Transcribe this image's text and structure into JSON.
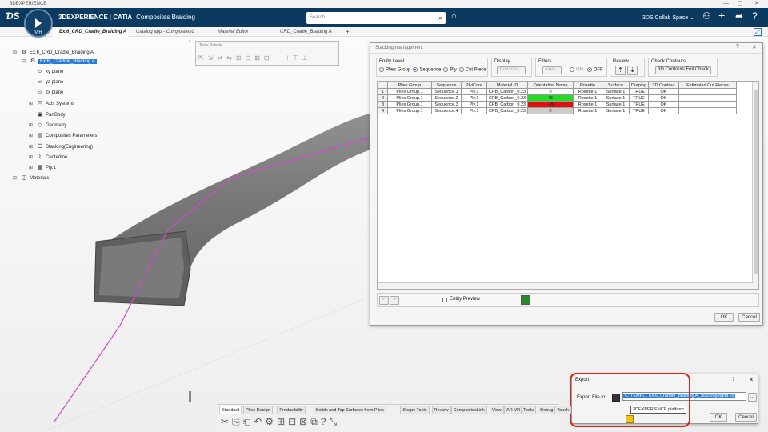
{
  "titlebar": {
    "app": "3DEXPERIENCE",
    "min": "—",
    "max": "▢",
    "close": "✕"
  },
  "header": {
    "brand_3dx": "3DEXPERIENCE",
    "brand_sep": " | ",
    "brand_catia": "CATIA",
    "app_name": "Composites Braiding",
    "compass_label": "V.R",
    "search_placeholder": "Search",
    "collab_space": "3DS Collab Space",
    "bg_color": "#0b3a61"
  },
  "tabs": [
    {
      "label": "Ex.6_CRD_Cradle_Braiding A"
    },
    {
      "label": "Catalog app - CompositesC"
    },
    {
      "label": "Material Editor"
    },
    {
      "label": "CRD_Cradle_Braiding A"
    },
    {
      "label": "+"
    }
  ],
  "tree": [
    {
      "label": "Ex.6_CRD_Cradle_Braiding A",
      "icon": "product-icon"
    },
    {
      "label": "Ex.6_ Craddle_Braiding A",
      "icon": "part-icon"
    },
    {
      "label": "xy plane",
      "icon": "plane-icon"
    },
    {
      "label": "yz plane",
      "icon": "plane-icon"
    },
    {
      "label": "zx plane",
      "icon": "plane-icon"
    },
    {
      "label": "Axis Systems",
      "icon": "axis-icon"
    },
    {
      "label": "PartBody",
      "icon": "body-icon"
    },
    {
      "label": "Geometry",
      "icon": "geometry-icon"
    },
    {
      "label": "Composites Parameters",
      "icon": "parameters-icon"
    },
    {
      "label": "Stacking(Engineering)",
      "icon": "stacking-icon"
    },
    {
      "label": "Centerline",
      "icon": "centerline-icon"
    },
    {
      "label": "Ply.1",
      "icon": "ply-icon"
    },
    {
      "label": "Materials",
      "icon": "materials-icon"
    }
  ],
  "tools_palette": {
    "title": "Tools Palette"
  },
  "stacking": {
    "title": "Stacking management",
    "help": "?",
    "close": "✕",
    "entity_level": {
      "label": "Entity Level",
      "options": [
        "Plies Group",
        "Sequence",
        "Ply",
        "Cut Piece"
      ],
      "selected": "Sequence"
    },
    "display": {
      "label": "Display",
      "button": "Columns..."
    },
    "filters": {
      "label": "Filters",
      "button": "Axes...",
      "on": "ON",
      "off": "OFF",
      "selected": "OFF"
    },
    "review": {
      "label": "Review"
    },
    "check_contours": {
      "label": "Check Contours",
      "button": "3D Contours Full Check"
    },
    "columns": [
      "",
      "Plies Group",
      "Sequence",
      "Ply/Core",
      "Material ID",
      "Orientation Name",
      "Rosette",
      "Surface",
      "Draping",
      "3D Contour",
      "Estimated Cut Pieces"
    ],
    "rows": [
      {
        "n": "1",
        "group": "Plies Group.1",
        "seq": "Sequence.1",
        "ply": "Ply.1",
        "mat": "CPB_Carbon_0.23",
        "orient": "0",
        "orient_color": "#ffffff",
        "rosette": "Rosette.1",
        "surface": "Surface.1",
        "draping": "TRUE",
        "contour": "OK",
        "cut": ""
      },
      {
        "n": "2",
        "group": "Plies Group.1",
        "seq": "Sequence.2",
        "ply": "Ply.1",
        "mat": "CPB_Carbon_0.23",
        "orient": "45",
        "orient_color": "#22dd22",
        "rosette": "Rosette.1",
        "surface": "Surface.1",
        "draping": "TRUE",
        "contour": "OK",
        "cut": ""
      },
      {
        "n": "3",
        "group": "Plies Group.1",
        "seq": "Sequence.3",
        "ply": "Ply.1",
        "mat": "CPB_Carbon_0.23",
        "orient": "-45",
        "orient_color": "#e01010",
        "rosette": "Rosette.1",
        "surface": "Surface.1",
        "draping": "TRUE",
        "contour": "OK",
        "cut": ""
      },
      {
        "n": "4",
        "group": "Plies Group.1",
        "seq": "Sequence.4",
        "ply": "Ply.1",
        "mat": "CPB_Carbon_0.23",
        "orient": "0",
        "orient_color": "#cccccc",
        "rosette": "Rosette.1",
        "surface": "Surface.1",
        "draping": "TRUE",
        "contour": "OK",
        "cut": ""
      }
    ],
    "entity_preview": "Entity Preview",
    "ok": "OK",
    "cancel": "Cancel"
  },
  "export": {
    "title": "Export",
    "help": "?",
    "close": "✕",
    "label": "Export File to:",
    "path": "C:\\TEMP\\... Ex.6_Craddle_Braiding A_StackingMgmt.xls",
    "tooltip": "3DEXPERIENCE platform",
    "ok": "OK",
    "cancel": "Cancel",
    "highlight_color": "#d9261c"
  },
  "action_tabs": [
    "Standard",
    "Plies Design",
    "Producibility",
    "Solids and Top Surfaces from Plies",
    "Shape Tools",
    "Review",
    "CompositesLink",
    "View",
    "AR-VR",
    "Tools",
    "Debug",
    "Touch"
  ],
  "action_tab_active": "Standard"
}
